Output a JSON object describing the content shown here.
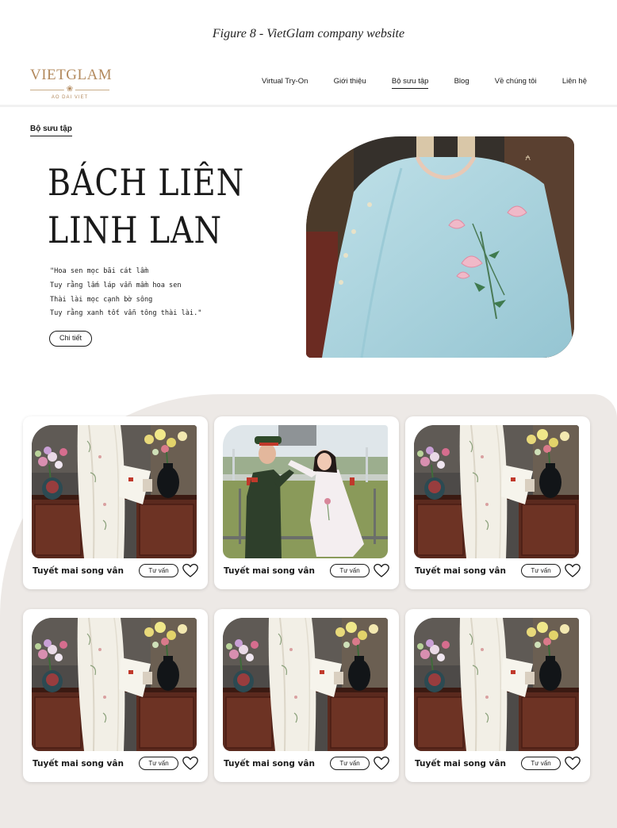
{
  "figure_caption": "Figure 8 - VietGlam company website",
  "logo": {
    "name": "VIETGLAM",
    "flower": "❀",
    "subtitle": "AO DAI VIET"
  },
  "nav": {
    "items": [
      {
        "label": "Virtual Try-On"
      },
      {
        "label": "Giới thiệu"
      },
      {
        "label": "Bộ sưu tập",
        "active": true
      },
      {
        "label": "Blog"
      },
      {
        "label": "Về chúng tôi"
      },
      {
        "label": "Liên hệ"
      }
    ]
  },
  "hero": {
    "breadcrumb": "Bộ sưu tập",
    "title_line1": "BÁCH LIÊN",
    "title_line2": "LINH LAN",
    "poem": [
      "\"Hoa sen mọc bãi cát lầm",
      "Tuy rằng lấm láp vẫn mầm hoa sen",
      "Thài lài mọc cạnh bờ sông",
      "Tuy rằng xanh tốt vẫn tông thài lài.\""
    ],
    "detail_button": "Chi tiết",
    "image_icon": "embroidered-lotus-ao-dai-photo"
  },
  "products": [
    {
      "name": "Tuyết mai song vân",
      "button": "Tư vấn",
      "image": "white-ao-dai-still-life"
    },
    {
      "name": "Tuyết mai song vân",
      "button": "Tư vấn",
      "image": "soldier-and-girl-photo"
    },
    {
      "name": "Tuyết mai song vân",
      "button": "Tư vấn",
      "image": "white-ao-dai-still-life"
    },
    {
      "name": "Tuyết mai song vân",
      "button": "Tư vấn",
      "image": "white-ao-dai-still-life"
    },
    {
      "name": "Tuyết mai song vân",
      "button": "Tư vấn",
      "image": "white-ao-dai-still-life"
    },
    {
      "name": "Tuyết mai song vân",
      "button": "Tư vấn",
      "image": "white-ao-dai-still-life"
    }
  ],
  "colors": {
    "brand_gold": "#b38a5e",
    "section_bg": "#ede9e6",
    "hero_dress": "#a9d3de"
  }
}
